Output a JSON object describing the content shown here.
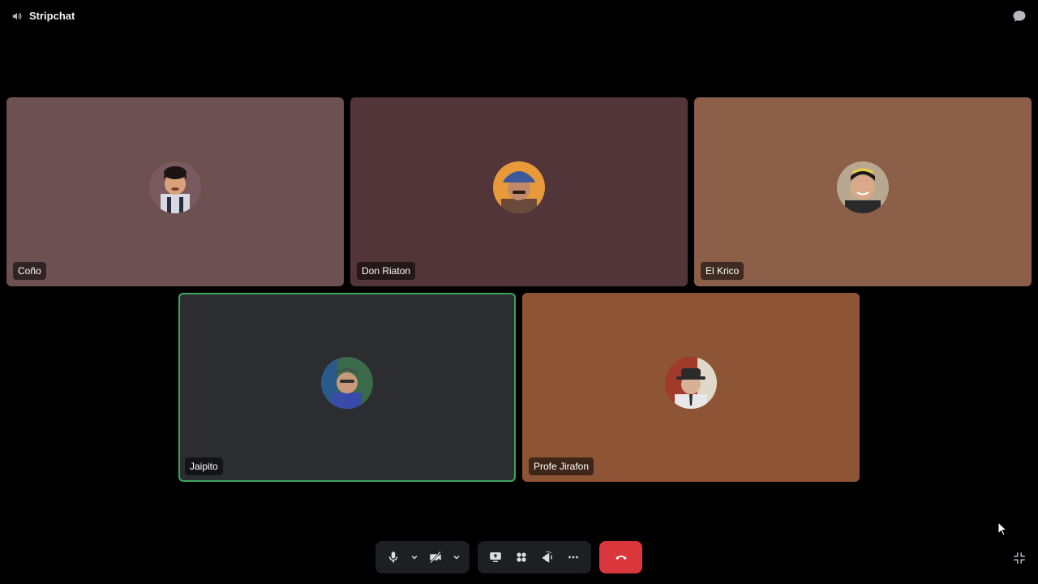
{
  "header": {
    "channel_name": "Stripchat",
    "channel_icon": "speaker-icon",
    "chat_icon": "chat-bubble-icon"
  },
  "participants": [
    {
      "name": "Coño",
      "tile_color": "#6d5052",
      "speaking": false
    },
    {
      "name": "Don Riaton",
      "tile_color": "#523539",
      "speaking": false
    },
    {
      "name": "El Krico",
      "tile_color": "#8c5f49",
      "speaking": false
    },
    {
      "name": "Jaipito",
      "tile_color": "#2b2d31",
      "speaking": true
    },
    {
      "name": "Profe Jirafon",
      "tile_color": "#8d5535",
      "speaking": false
    }
  ],
  "controls": {
    "icons": [
      "microphone-icon",
      "chevron-down-icon",
      "camera-off-icon",
      "chevron-down-icon",
      "screen-share-icon",
      "activities-icon",
      "soundboard-icon",
      "more-icon",
      "disconnect-icon"
    ]
  },
  "colors": {
    "background": "#000000",
    "speaking_ring": "#3ba55c",
    "leave_button": "#da373c",
    "control_bar": "#1e1f22"
  }
}
